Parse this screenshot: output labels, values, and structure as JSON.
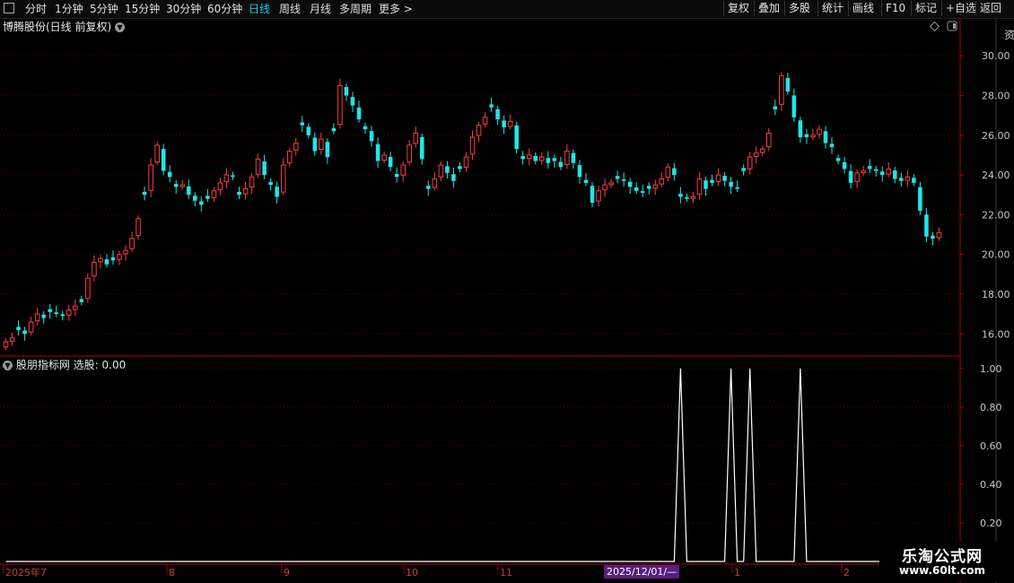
{
  "toolbar": {
    "periods": [
      "分时",
      "1分钟",
      "5分钟",
      "15分钟",
      "30分钟",
      "60分钟",
      "日线",
      "周线",
      "月线",
      "多周期",
      "更多 >"
    ],
    "active_period": "日线",
    "right_buttons": [
      "复权",
      "叠加",
      "多股",
      "统计",
      "画线",
      "F10",
      "标记",
      "+自选",
      "返回"
    ]
  },
  "main": {
    "title": "博腾股份(日线 前复权)"
  },
  "indicator": {
    "title": "股朋指标网 选股: 0.00"
  },
  "xaxis": {
    "labels": [
      "2025年7",
      "8",
      "9",
      "10",
      "11",
      "1",
      "2"
    ],
    "cursor_date": "2025/12/01/—"
  },
  "watermark": {
    "title": "乐淘公式网",
    "url": "www.60lt.com"
  },
  "colors": {
    "up": "#ff3c3c",
    "down": "#1ee6e6",
    "grid": "#5a0000",
    "axis": "#b00000"
  },
  "chart_data": [
    {
      "type": "candlestick",
      "title": "博腾股份(日线 前复权)",
      "ylim": [
        15.2,
        31.0
      ],
      "yticks": [
        16.0,
        18.0,
        20.0,
        22.0,
        24.0,
        26.0,
        28.0,
        30.0
      ],
      "close": [
        15.6,
        15.8,
        16.2,
        16.0,
        16.6,
        17.0,
        16.8,
        17.1,
        17.0,
        16.9,
        17.2,
        17.4,
        17.6,
        18.8,
        19.6,
        19.8,
        19.5,
        19.7,
        20.0,
        20.2,
        20.8,
        21.8,
        23.0,
        24.5,
        25.5,
        24.2,
        23.9,
        23.4,
        23.5,
        23.0,
        22.7,
        22.5,
        22.8,
        23.2,
        23.6,
        24.0,
        23.9,
        23.0,
        23.3,
        23.9,
        24.8,
        24.0,
        23.5,
        22.9,
        24.5,
        25.2,
        25.6,
        26.5,
        26.0,
        25.2,
        25.8,
        24.9,
        26.2,
        28.5,
        28.0,
        27.5,
        26.8,
        26.3,
        25.7,
        24.7,
        25.0,
        24.4,
        23.9,
        24.5,
        25.5,
        26.1,
        24.8,
        23.3,
        23.8,
        24.5,
        24.1,
        23.7,
        24.3,
        24.9,
        25.9,
        26.5,
        26.9,
        27.4,
        26.8,
        26.4,
        26.7,
        25.3,
        24.8,
        25.0,
        24.7,
        24.9,
        24.6,
        24.7,
        24.4,
        25.2,
        24.6,
        23.9,
        23.6,
        22.6,
        23.2,
        23.5,
        23.6,
        23.8,
        23.7,
        23.4,
        23.2,
        23.1,
        23.3,
        23.5,
        23.8,
        24.4,
        24.0,
        22.9,
        22.8,
        22.9,
        23.8,
        23.3,
        23.6,
        24.0,
        23.7,
        23.4,
        23.3,
        24.2,
        24.9,
        25.1,
        25.3,
        26.1,
        27.3,
        29.0,
        28.2,
        26.9,
        25.9,
        25.9,
        26.0,
        26.3,
        25.6,
        25.4,
        24.7,
        24.3,
        23.6,
        24.1,
        24.2,
        24.3,
        24.2,
        24.0,
        24.3,
        23.8,
        23.7,
        23.9,
        23.6,
        22.2,
        20.9,
        20.8,
        21.1
      ]
    },
    {
      "type": "line",
      "title": "股朋指标网 选股: 0.00",
      "ylim": [
        0,
        1.05
      ],
      "yticks": [
        0.2,
        0.4,
        0.6,
        0.8,
        1.0
      ],
      "values": [
        0,
        0,
        0,
        0,
        0,
        0,
        0,
        0,
        0,
        0,
        0,
        0,
        0,
        0,
        0,
        0,
        0,
        0,
        0,
        0,
        0,
        0,
        0,
        0,
        0,
        0,
        0,
        0,
        0,
        0,
        0,
        0,
        0,
        0,
        0,
        0,
        0,
        0,
        0,
        0,
        0,
        0,
        0,
        0,
        0,
        0,
        0,
        0,
        0,
        0,
        0,
        0,
        0,
        0,
        0,
        0,
        0,
        0,
        0,
        0,
        0,
        0,
        0,
        0,
        0,
        0,
        0,
        0,
        0,
        0,
        0,
        0,
        0,
        0,
        0,
        0,
        0,
        0,
        0,
        0,
        0,
        0,
        0,
        0,
        0,
        0,
        0,
        0,
        0,
        0,
        0,
        0,
        0,
        0,
        0,
        0,
        0,
        0,
        0,
        0,
        0,
        0,
        0,
        0,
        0,
        0,
        0,
        1,
        0,
        0,
        0,
        0,
        0,
        0,
        0,
        1,
        0,
        0,
        1,
        0,
        0,
        0,
        0,
        0,
        0,
        0,
        1,
        0,
        0,
        0,
        0,
        0,
        0,
        0,
        0,
        0,
        0,
        0,
        0,
        0,
        0,
        0,
        0,
        0,
        0,
        0,
        0,
        0,
        0,
        0
      ]
    }
  ]
}
